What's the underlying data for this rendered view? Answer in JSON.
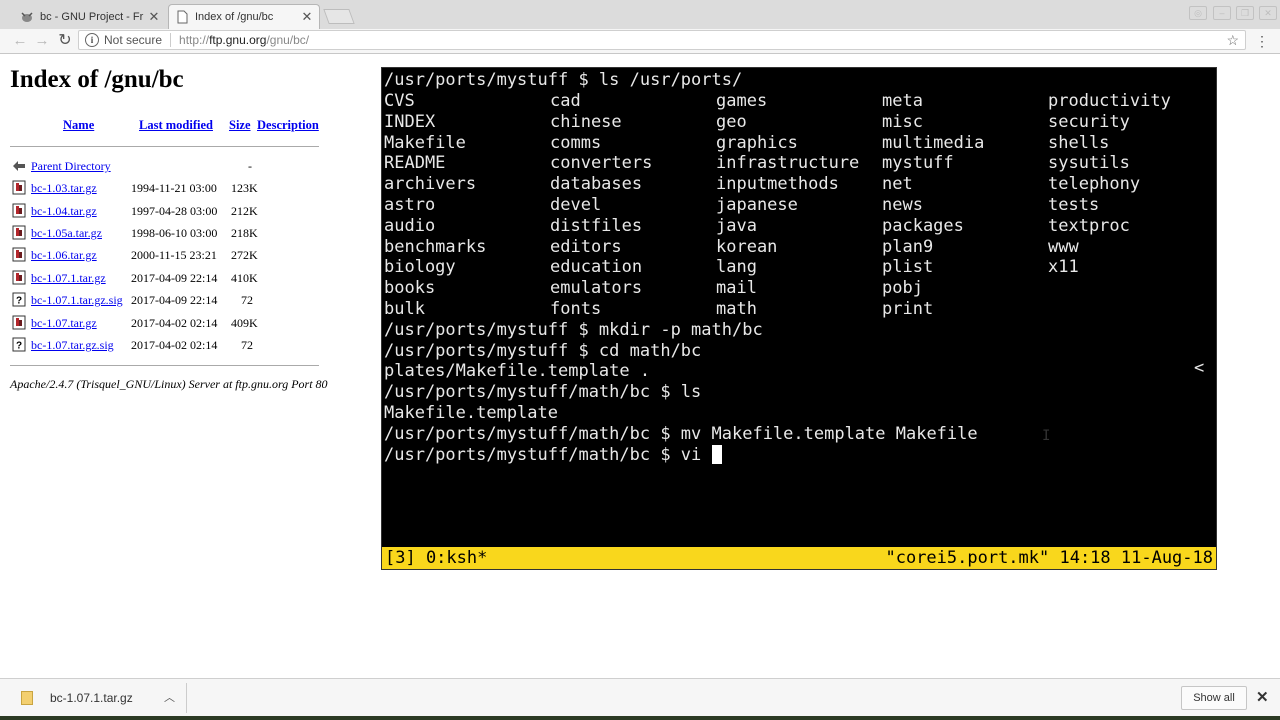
{
  "browser": {
    "tabs": [
      {
        "label": "bc - GNU Project - Fr",
        "active": false,
        "icon": "gnu-favicon-icon"
      },
      {
        "label": "Index of /gnu/bc",
        "active": true,
        "icon": "page-icon"
      }
    ],
    "address": {
      "security": "Not secure",
      "scheme": "http://",
      "host": "ftp.gnu.org",
      "path": "/gnu/bc/"
    }
  },
  "page": {
    "title": "Index of /gnu/bc",
    "columns": {
      "name": "Name",
      "modified": "Last modified",
      "size": "Size",
      "description": "Description"
    },
    "parent": {
      "name": "Parent Directory",
      "size": "-"
    },
    "files": [
      {
        "name": "bc-1.03.tar.gz",
        "date": "1994-11-21 03:00",
        "size": "123K",
        "icon": "archive-icon"
      },
      {
        "name": "bc-1.04.tar.gz",
        "date": "1997-04-28 03:00",
        "size": "212K",
        "icon": "archive-icon"
      },
      {
        "name": "bc-1.05a.tar.gz",
        "date": "1998-06-10 03:00",
        "size": "218K",
        "icon": "archive-icon"
      },
      {
        "name": "bc-1.06.tar.gz",
        "date": "2000-11-15 23:21",
        "size": "272K",
        "icon": "archive-icon"
      },
      {
        "name": "bc-1.07.1.tar.gz",
        "date": "2017-04-09 22:14",
        "size": "410K",
        "icon": "archive-icon"
      },
      {
        "name": "bc-1.07.1.tar.gz.sig",
        "date": "2017-04-09 22:14",
        "size": "72",
        "icon": "unknown-file-icon"
      },
      {
        "name": "bc-1.07.tar.gz",
        "date": "2017-04-02 02:14",
        "size": "409K",
        "icon": "archive-icon"
      },
      {
        "name": "bc-1.07.tar.gz.sig",
        "date": "2017-04-02 02:14",
        "size": "72",
        "icon": "unknown-file-icon"
      }
    ],
    "address_line": "Apache/2.4.7 (Trisquel_GNU/Linux) Server at ftp.gnu.org Port 80"
  },
  "terminal": {
    "prompt1": "/usr/ports/mystuff $ ls /usr/ports/",
    "ls_columns": [
      [
        "CVS",
        "INDEX",
        "Makefile",
        "README",
        "archivers",
        "astro",
        "audio",
        "benchmarks",
        "biology",
        "books",
        "bulk"
      ],
      [
        "cad",
        "chinese",
        "comms",
        "converters",
        "databases",
        "devel",
        "distfiles",
        "editors",
        "education",
        "emulators",
        "fonts"
      ],
      [
        "games",
        "geo",
        "graphics",
        "infrastructure",
        "inputmethods",
        "japanese",
        "java",
        "korean",
        "lang",
        "mail",
        "math"
      ],
      [
        "meta",
        "misc",
        "multimedia",
        "mystuff",
        "net",
        "news",
        "packages",
        "plan9",
        "plist",
        "pobj",
        "print"
      ],
      [
        "productivity",
        "security",
        "shells",
        "sysutils",
        "telephony",
        "tests",
        "textproc",
        "www",
        "x11"
      ]
    ],
    "lines_after": [
      "/usr/ports/mystuff $ mkdir -p math/bc",
      "/usr/ports/mystuff $ cd math/bc",
      "plates/Makefile.template .",
      "/usr/ports/mystuff/math/bc $ ls",
      "Makefile.template",
      "/usr/ports/mystuff/math/bc $ mv Makefile.template Makefile"
    ],
    "current_line": "/usr/ports/mystuff/math/bc $ vi ",
    "overflow_marker": "<",
    "status_left": "[3] 0:ksh*",
    "status_right": "\"corei5.port.mk\" 14:18 11-Aug-18",
    "status_color": "#f9d71c"
  },
  "downloads": {
    "file": "bc-1.07.1.tar.gz",
    "show_all": "Show all"
  }
}
